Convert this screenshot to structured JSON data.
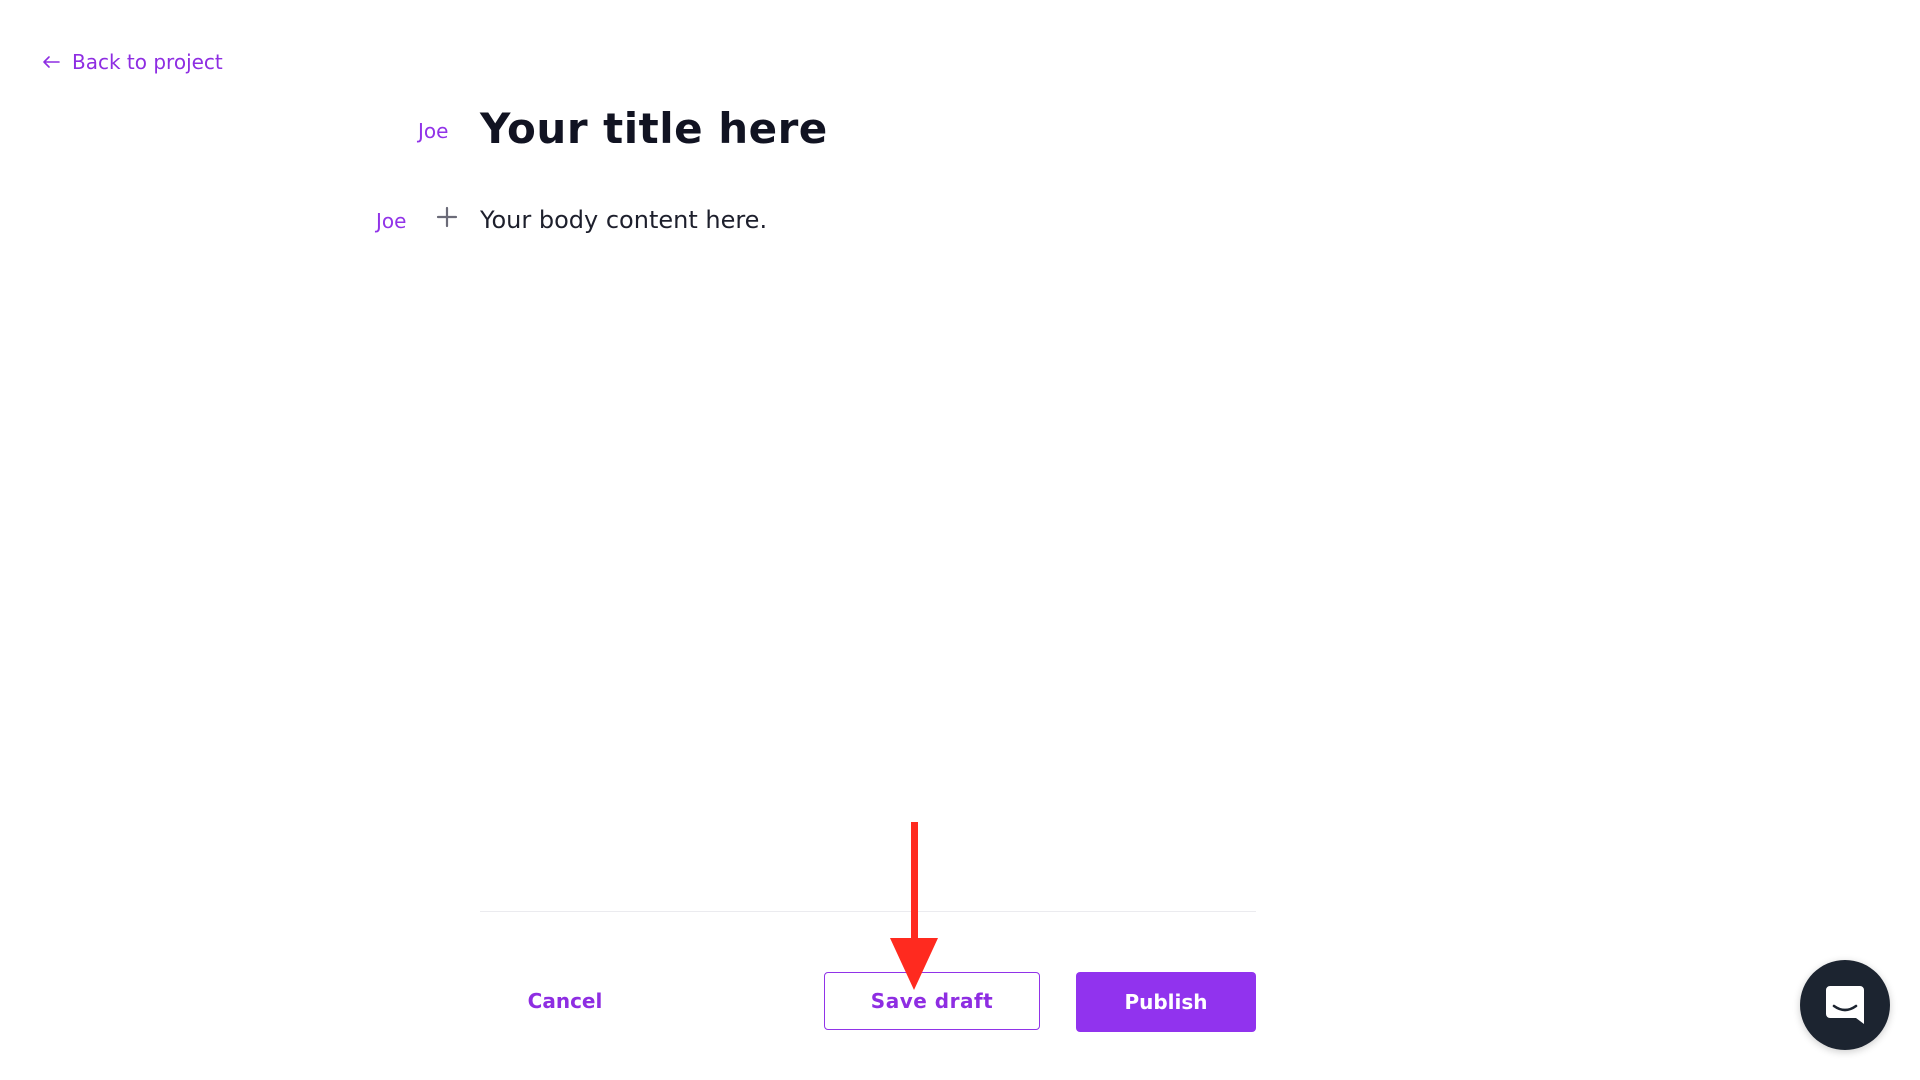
{
  "nav": {
    "back_label": "Back to project",
    "back_icon": "arrow-left-icon"
  },
  "document": {
    "title": "Your title here",
    "title_author": "Joe",
    "body": "Your body content here.",
    "body_author": "Joe",
    "add_block_icon": "plus-icon"
  },
  "footer": {
    "cancel_label": "Cancel",
    "save_draft_label": "Save draft",
    "publish_label": "Publish"
  },
  "annotation": {
    "type": "arrow-down",
    "color": "#ff2a1f",
    "target": "save-draft-button"
  },
  "chat": {
    "icon": "chat-icon"
  },
  "colors": {
    "accent": "#9133e8",
    "title_text": "#111322",
    "body_text": "#1d1f2c",
    "chat_bg": "#1c2430"
  }
}
